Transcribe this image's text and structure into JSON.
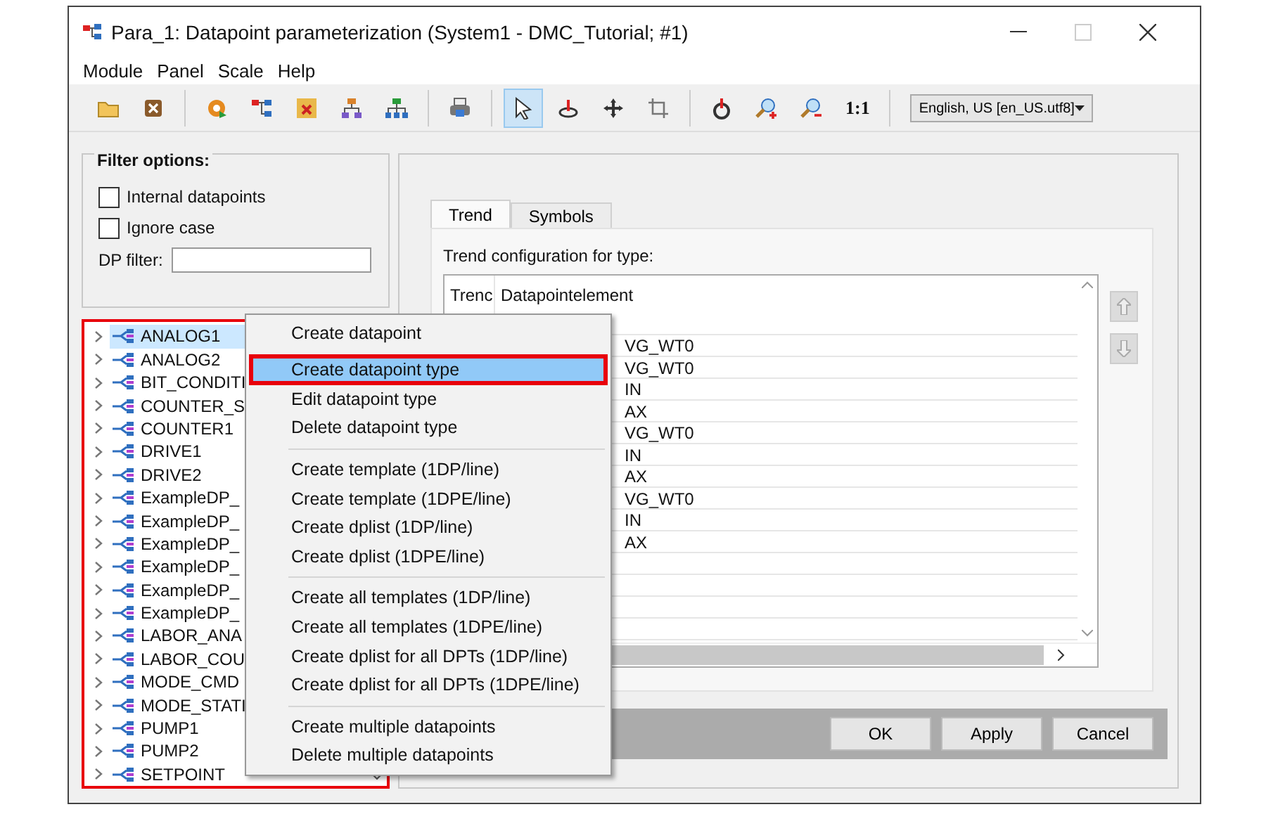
{
  "window": {
    "title": "Para_1: Datapoint parameterization (System1 - DMC_Tutorial; #1)",
    "maximize_disabled": true
  },
  "menu": [
    "Module",
    "Panel",
    "Scale",
    "Help"
  ],
  "toolbar": {
    "tools": [
      {
        "selected": false
      },
      {
        "selected": false
      },
      {
        "selected": false
      },
      {
        "selected": false
      },
      {
        "selected": false
      },
      {
        "selected": false
      },
      {
        "selected": false
      },
      {
        "selected": false
      },
      {
        "selected": true
      },
      {
        "selected": false
      },
      {
        "selected": false
      },
      {
        "selected": false
      },
      {
        "selected": false
      },
      {
        "selected": false
      },
      {
        "selected": false
      }
    ],
    "scale_label": "1:1",
    "language": "English, US [en_US.utf8]"
  },
  "filter": {
    "title": "Filter options:",
    "options": [
      {
        "label": "Internal datapoints",
        "checked": false
      },
      {
        "label": "Ignore case",
        "checked": false
      }
    ],
    "dp_filter_label": "DP filter:"
  },
  "tree": {
    "annotated": true,
    "items": [
      {
        "label": "ANALOG1",
        "selected": true
      },
      {
        "label": "ANALOG2",
        "selected": false
      },
      {
        "label": "BIT_CONDITI",
        "selected": false
      },
      {
        "label": "COUNTER_S",
        "selected": false
      },
      {
        "label": "COUNTER1",
        "selected": false
      },
      {
        "label": "DRIVE1",
        "selected": false
      },
      {
        "label": "DRIVE2",
        "selected": false
      },
      {
        "label": "ExampleDP_",
        "selected": false
      },
      {
        "label": "ExampleDP_",
        "selected": false
      },
      {
        "label": "ExampleDP_",
        "selected": false
      },
      {
        "label": "ExampleDP_",
        "selected": false
      },
      {
        "label": "ExampleDP_",
        "selected": false
      },
      {
        "label": "ExampleDP_",
        "selected": false
      },
      {
        "label": "LABOR_ANA",
        "selected": false
      },
      {
        "label": "LABOR_COU",
        "selected": false
      },
      {
        "label": "MODE_CMD",
        "selected": false
      },
      {
        "label": "MODE_STATI",
        "selected": false
      },
      {
        "label": "PUMP1",
        "selected": false
      },
      {
        "label": "PUMP2",
        "selected": false
      },
      {
        "label": "SETPOINT",
        "selected": false
      }
    ]
  },
  "tabs": [
    {
      "label": "Trend",
      "selected": true
    },
    {
      "label": "Symbols",
      "selected": false
    }
  ],
  "trend": {
    "caption": "Trend configuration for type:",
    "columns": [
      "Trenc",
      "Datapointelement"
    ],
    "rows": [
      "VG_WT0",
      "VG_WT0",
      "IN",
      "AX",
      "VG_WT0",
      "IN",
      "AX",
      "VG_WT0",
      "IN",
      "AX"
    ]
  },
  "buttons": [
    "OK",
    "Apply",
    "Cancel"
  ],
  "context_menu": {
    "groups": [
      [
        {
          "label": "Create datapoint",
          "selected": false,
          "annotated": false
        },
        {
          "label": "Create datapoint type",
          "selected": true,
          "annotated": true
        },
        {
          "label": "Edit datapoint type",
          "selected": false,
          "annotated": false
        },
        {
          "label": "Delete datapoint type",
          "selected": false,
          "annotated": false
        }
      ],
      [
        {
          "label": "Create template (1DP/line)",
          "selected": false,
          "annotated": false
        },
        {
          "label": "Create template (1DPE/line)",
          "selected": false,
          "annotated": false
        },
        {
          "label": "Create dplist (1DP/line)",
          "selected": false,
          "annotated": false
        },
        {
          "label": "Create dplist (1DPE/line)",
          "selected": false,
          "annotated": false
        }
      ],
      [
        {
          "label": "Create all templates (1DP/line)",
          "selected": false,
          "annotated": false
        },
        {
          "label": "Create all templates (1DPE/line)",
          "selected": false,
          "annotated": false
        },
        {
          "label": "Create dplist for all DPTs (1DP/line)",
          "selected": false,
          "annotated": false
        },
        {
          "label": "Create dplist for all DPTs (1DPE/line)",
          "selected": false,
          "annotated": false
        }
      ],
      [
        {
          "label": "Create multiple datapoints",
          "selected": false,
          "annotated": false
        },
        {
          "label": "Delete multiple datapoints",
          "selected": false,
          "annotated": false
        }
      ]
    ]
  }
}
